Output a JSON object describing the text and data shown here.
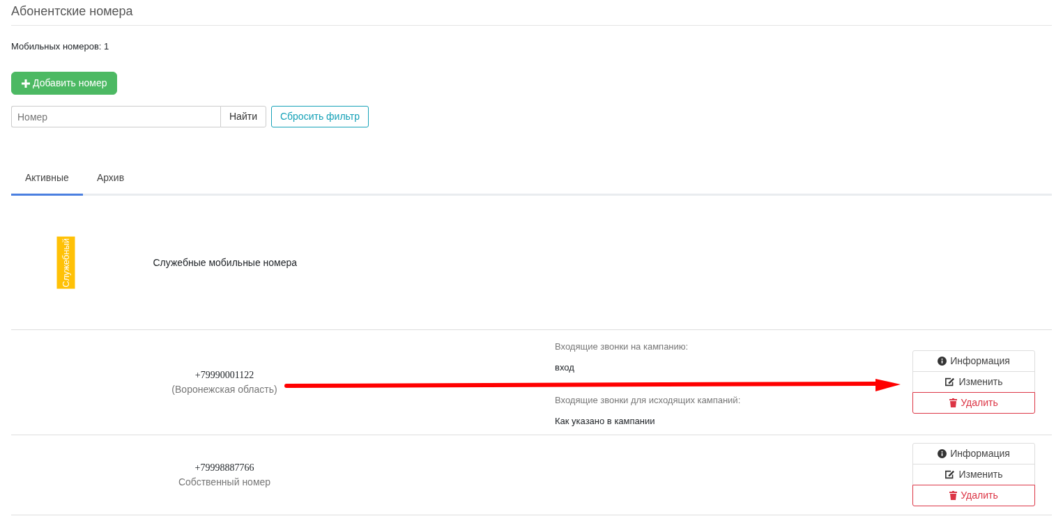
{
  "page": {
    "title": "Абонентские номера"
  },
  "summary": {
    "label": "Мобильных номеров:",
    "count": "1"
  },
  "add_button": {
    "label": "Добавить номер"
  },
  "filter": {
    "placeholder": "Номер",
    "search_button": "Найти",
    "reset_button": "Сбросить фильтр"
  },
  "tabs": [
    {
      "label": "Активные",
      "selected": true
    },
    {
      "label": "Архив",
      "selected": false
    }
  ],
  "group": {
    "badge": "Служебный",
    "title": "Служебные мобильные номера"
  },
  "rows": [
    {
      "phone": "+79990001122",
      "note": "(Воронежская область)",
      "arrow": true,
      "fields": [
        {
          "label": "Входящие звонки на кампанию:",
          "value": "вход"
        },
        {
          "label": "Входящие звонки для исходящих кампаний:",
          "value": "Как указано в кампании"
        }
      ],
      "actions": [
        {
          "kind": "info",
          "label": "Информация"
        },
        {
          "kind": "edit",
          "label": "Изменить"
        },
        {
          "kind": "delete",
          "label": "Удалить"
        }
      ]
    },
    {
      "phone": "+79998887766",
      "note": "Собственный номер",
      "arrow": false,
      "actions": [
        {
          "kind": "info",
          "label": "Информация"
        },
        {
          "kind": "edit",
          "label": "Изменить"
        },
        {
          "kind": "delete",
          "label": "Удалить"
        }
      ]
    }
  ]
}
